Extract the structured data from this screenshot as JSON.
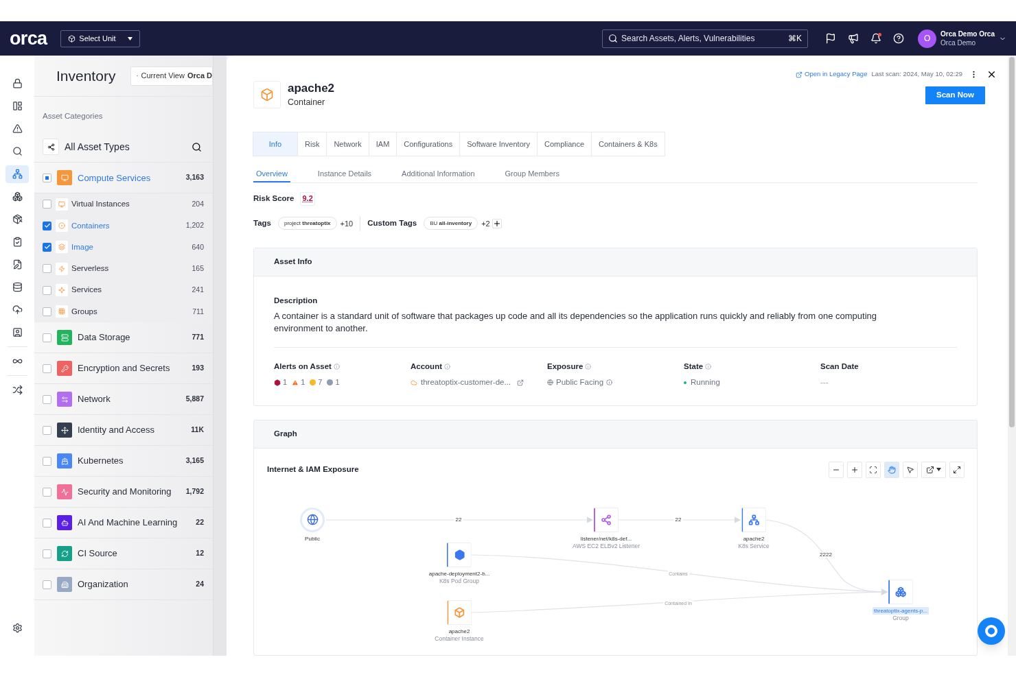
{
  "nav": {
    "logo": "orca",
    "unit_select": "Select Unit",
    "search_placeholder": "Search Assets, Alerts, Vulnerabilities",
    "shortcut": "⌘K",
    "notification_dot": true,
    "avatar_letter": "O",
    "user_name": "Orca Demo Orca",
    "user_org": "Orca Demo"
  },
  "rail_items": [
    {
      "selected": false
    },
    {
      "selected": false
    },
    {
      "selected": false
    },
    {
      "selected": false
    },
    {
      "selected": true
    },
    {
      "selected": false
    },
    {
      "selected": false
    },
    {
      "selected": false
    },
    {
      "selected": false
    },
    {
      "selected": false
    },
    {
      "selected": false
    },
    {
      "selected": false
    },
    {
      "selected": false
    },
    {
      "selected": false
    },
    {
      "selected": false
    }
  ],
  "inventory": {
    "title": "Inventory",
    "view_label": "Current View",
    "view_name": "Orca D",
    "categories_label": "Asset Categories",
    "all_types": "All Asset Types",
    "categories": [
      {
        "label": "Compute Services",
        "count": "3,163",
        "checked": false,
        "partial": true,
        "selected": true,
        "color": "#f7953b",
        "children": [
          {
            "label": "Virtual Instances",
            "count": "204",
            "checked": false
          },
          {
            "label": "Containers",
            "count": "1,202",
            "checked": true
          },
          {
            "label": "Image",
            "count": "640",
            "checked": true
          },
          {
            "label": "Serverless",
            "count": "165",
            "checked": false
          },
          {
            "label": "Services",
            "count": "241",
            "checked": false
          },
          {
            "label": "Groups",
            "count": "711",
            "checked": false
          }
        ]
      },
      {
        "label": "Data Storage",
        "count": "771",
        "checked": false,
        "selected": false,
        "color": "#22b35e"
      },
      {
        "label": "Encryption and Secrets",
        "count": "193",
        "checked": false,
        "selected": false,
        "color": "#ee6262"
      },
      {
        "label": "Network",
        "count": "5,887",
        "checked": false,
        "selected": false,
        "color": "#b26ef0"
      },
      {
        "label": "Identity and Access",
        "count": "11K",
        "checked": false,
        "selected": false,
        "color": "#34404f"
      },
      {
        "label": "Kubernetes",
        "count": "3,165",
        "checked": false,
        "selected": false,
        "color": "#4a86f7"
      },
      {
        "label": "Security and Monitoring",
        "count": "1,792",
        "checked": false,
        "selected": false,
        "color": "#f0709a"
      },
      {
        "label": "AI And Machine Learning",
        "count": "22",
        "checked": false,
        "selected": false,
        "color": "#5b1ee8"
      },
      {
        "label": "CI Source",
        "count": "12",
        "checked": false,
        "selected": false,
        "color": "#15a08a"
      },
      {
        "label": "Organization",
        "count": "24",
        "checked": false,
        "selected": false,
        "color": "#97a9c4"
      }
    ]
  },
  "detail": {
    "title": "apache2",
    "subtitle": "Container",
    "legacy_link": "Open in Legacy Page",
    "last_scan": "Last scan: 2024, May 10, 02:29",
    "scan_button": "Scan Now",
    "tabs": [
      {
        "label": "Info",
        "selected": true
      },
      {
        "label": "Risk",
        "selected": false
      },
      {
        "label": "Network",
        "selected": false
      },
      {
        "label": "IAM",
        "selected": false
      },
      {
        "label": "Configurations",
        "selected": false
      },
      {
        "label": "Software Inventory",
        "selected": false
      },
      {
        "label": "Compliance",
        "selected": false
      },
      {
        "label": "Containers & K8s",
        "selected": false
      }
    ],
    "subtabs": [
      {
        "label": "Overview",
        "selected": true
      },
      {
        "label": "Instance Details",
        "selected": false
      },
      {
        "label": "Additional Information",
        "selected": false
      },
      {
        "label": "Group Members",
        "selected": false
      }
    ],
    "risk_label": "Risk Score",
    "risk_value": "9.2",
    "tags_label": "Tags",
    "tag": "project **threatoptix**",
    "tags_more": "+10",
    "custom_tags_label": "Custom Tags",
    "custom_tag": "BU **all-inventory**",
    "custom_tags_more": "+2"
  },
  "asset_info": {
    "title": "Asset Info",
    "description_label": "Description",
    "description": "A container is a standard unit of software that packages up code and all its dependencies so the application runs quickly and reliably from one computing environment to another.",
    "fields": [
      {
        "label": "Alerts on Asset",
        "info": true,
        "kind": "alerts",
        "alerts": [
          {
            "count": "1",
            "color": "#b0103a",
            "kind": "hexagon"
          },
          {
            "count": "1",
            "color": "#f26b1d",
            "kind": "triangle"
          },
          {
            "count": "7",
            "color": "#f5b82e",
            "kind": "circle"
          },
          {
            "count": "1",
            "color": "#8e9bb5",
            "kind": "circle"
          }
        ]
      },
      {
        "label": "Account",
        "info": true,
        "kind": "account",
        "value": "threatoptix-customer-de..."
      },
      {
        "label": "Exposure",
        "info": true,
        "kind": "exposure",
        "value": "Public Facing"
      },
      {
        "label": "State",
        "info": true,
        "kind": "state",
        "value": "Running",
        "color": "#20b27a"
      },
      {
        "label": "Scan Date",
        "kind": "text",
        "value": "---"
      }
    ]
  },
  "graph": {
    "title": "Graph",
    "subtitle": "Internet & IAM Exposure",
    "tools": [
      {
        "kind": "zoom-out",
        "selected": false
      },
      {
        "kind": "zoom-in",
        "selected": false
      },
      {
        "kind": "fit",
        "selected": false
      },
      {
        "kind": "pan",
        "selected": true
      },
      {
        "kind": "select",
        "selected": false
      },
      {
        "kind": "export",
        "selected": false
      },
      {
        "kind": "fullscreen",
        "selected": false
      }
    ],
    "nodes": [
      {
        "name": "Public",
        "kind": "internet",
        "color": "#3b6fd6",
        "selected": false
      },
      {
        "name": "listener/net/k8s-def...",
        "type": "AWS EC2 ELBv2 Listener",
        "kind": "listener",
        "color": "#b160e0",
        "selected": false
      },
      {
        "name": "apache2",
        "type": "K8s Service",
        "kind": "service",
        "color": "#3b78f0",
        "selected": false
      },
      {
        "name": "apache-deployment2-b...",
        "type": "K8s Pod Group",
        "kind": "pod",
        "color": "#3b78f0",
        "selected": false
      },
      {
        "name": "apache2",
        "type": "Container Instance",
        "kind": "container",
        "color": "#f7953b",
        "selected": false
      },
      {
        "name": "threatoptix-agents-p...",
        "type": "Group",
        "kind": "group",
        "color": "#3b78f0",
        "selected": true
      }
    ],
    "edges": [
      {
        "label": "22"
      },
      {
        "label": "22"
      },
      {
        "label": "2222"
      },
      {
        "label": "Contains"
      },
      {
        "label": "Contained In"
      }
    ]
  }
}
